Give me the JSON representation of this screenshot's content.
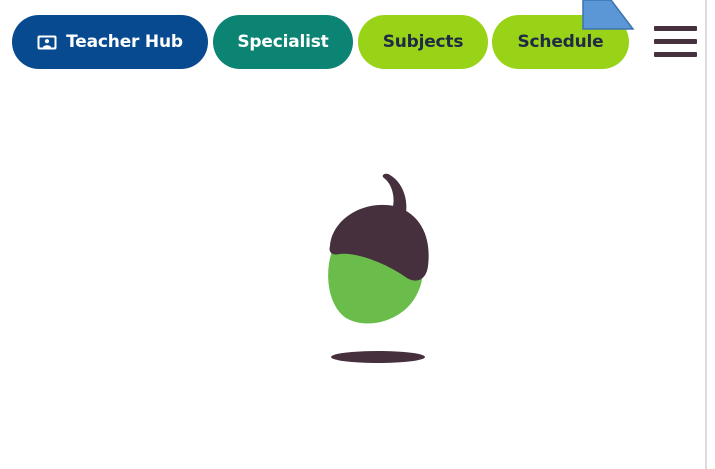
{
  "nav": {
    "teacher_hub_label": "Teacher Hub",
    "specialist_label": "Specialist",
    "subjects_label": "Subjects",
    "schedule_label": "Schedule"
  },
  "icons": {
    "teacher_hub": "presenter-screen-icon",
    "menu": "hamburger-menu-icon",
    "loader": "acorn-icon",
    "annotation": "pointer-arrow-icon"
  },
  "colors": {
    "teacher_hub_bg": "#084a8f",
    "specialist_bg": "#0b8474",
    "subjects_bg": "#99d318",
    "schedule_bg": "#99d318",
    "menu": "#46303e",
    "acorn_cap": "#46303e",
    "acorn_body": "#6abd4b",
    "arrow": "#5b97d6"
  }
}
